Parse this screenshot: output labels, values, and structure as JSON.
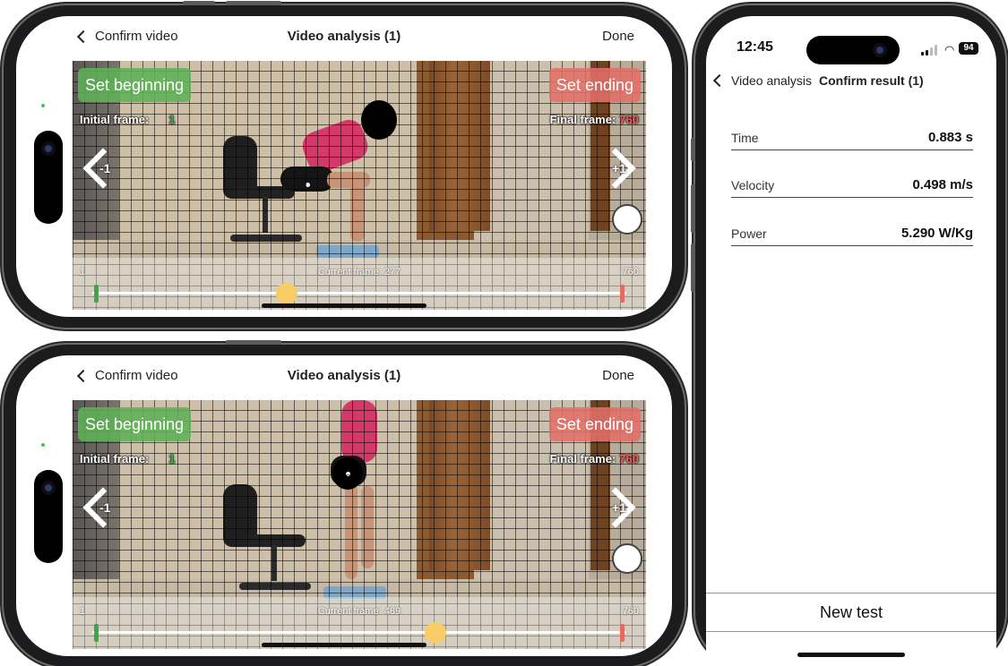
{
  "phones": [
    {
      "nav": {
        "back_label": "Confirm video",
        "title": "Video analysis (1)",
        "done_label": "Done"
      },
      "video": {
        "set_beginning_label": "Set beginning",
        "set_ending_label": "Set ending",
        "initial_frame_label": "Initial frame:",
        "initial_frame_value": "1",
        "final_frame_label": "Final frame:",
        "final_frame_value": "760",
        "step_back_label": "-1",
        "step_forward_label": "+1"
      },
      "slider": {
        "min_label": "1",
        "max_label": "760",
        "current_label": "Current frame: 277",
        "min": 1,
        "max": 760,
        "current": 277
      }
    },
    {
      "nav": {
        "back_label": "Confirm video",
        "title": "Video analysis (1)",
        "done_label": "Done"
      },
      "video": {
        "set_beginning_label": "Set beginning",
        "set_ending_label": "Set ending",
        "initial_frame_label": "Initial frame:",
        "initial_frame_value": "1",
        "final_frame_label": "Final frame:",
        "final_frame_value": "760",
        "step_back_label": "-1",
        "step_forward_label": "+1"
      },
      "slider": {
        "min_label": "1",
        "max_label": "760",
        "current_label": "Current frame: 489",
        "min": 1,
        "max": 760,
        "current": 489
      }
    }
  ],
  "result_screen": {
    "status": {
      "time": "12:45",
      "battery": "94"
    },
    "nav": {
      "back_label": "Video analysis",
      "title": "Confirm result (1)"
    },
    "results": [
      {
        "label": "Time",
        "value": "0.883 s"
      },
      {
        "label": "Velocity",
        "value": "0.498 m/s"
      },
      {
        "label": "Power",
        "value": "5.290 W/Kg"
      }
    ],
    "new_test_label": "New test"
  },
  "colors": {
    "set_beginning": "#5eb256",
    "set_ending": "#e27068",
    "slider_thumb": "#f8cd68",
    "initial_frame_value": "#3db04a",
    "final_frame_value": "#ff5a5a"
  }
}
